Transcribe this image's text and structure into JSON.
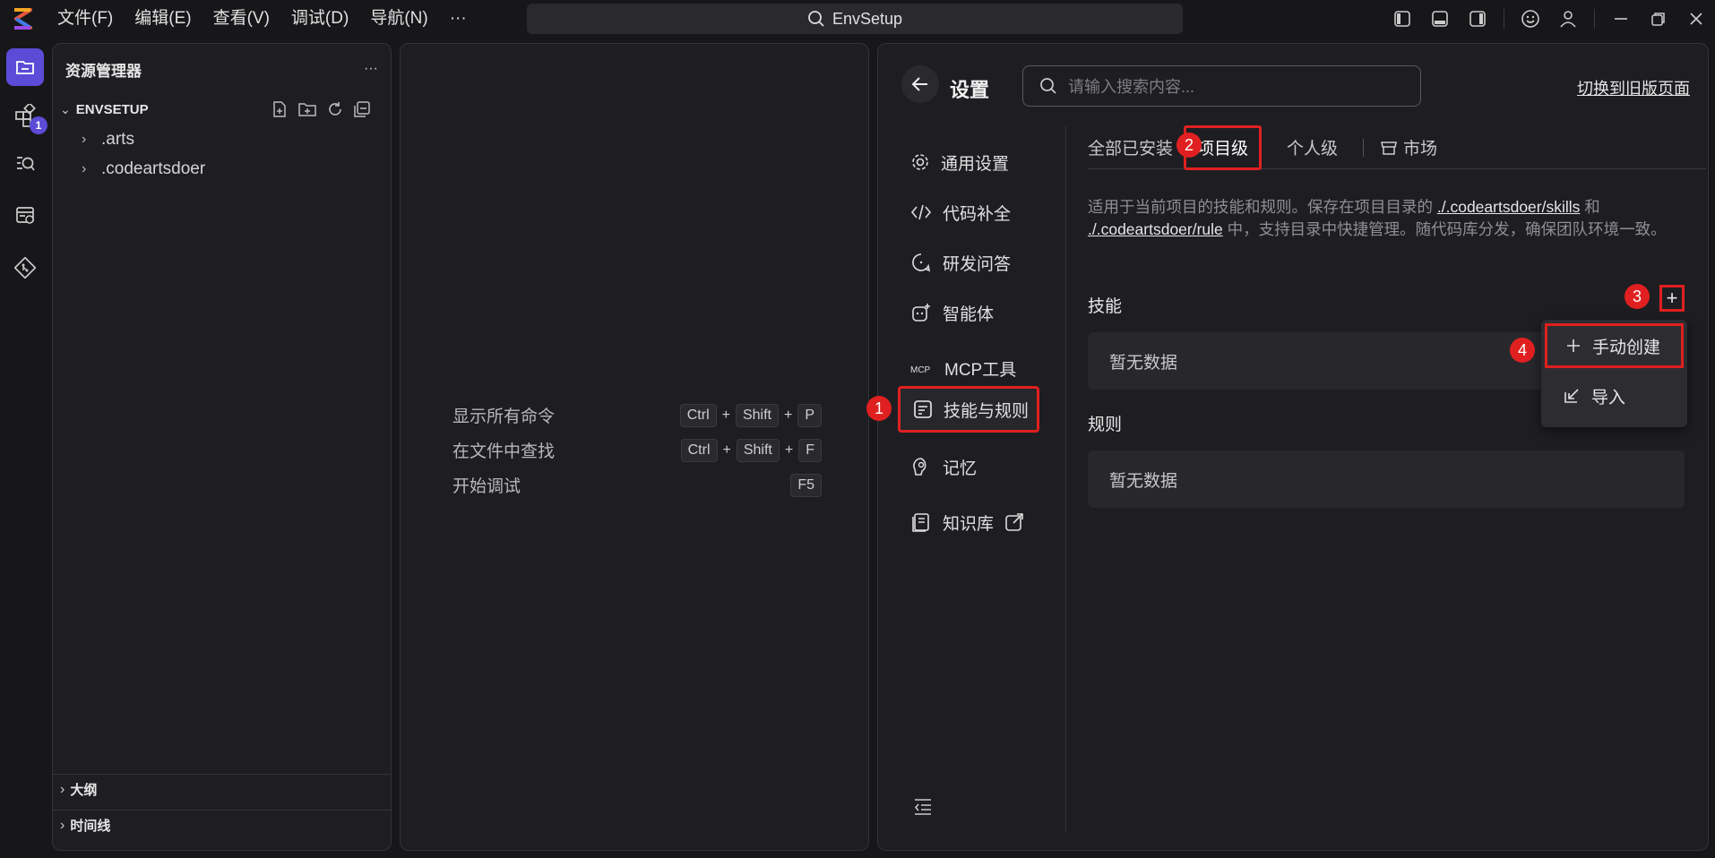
{
  "titlebar": {
    "menu": [
      "文件(F)",
      "编辑(E)",
      "查看(V)",
      "调试(D)",
      "导航(N)",
      "···"
    ],
    "search": "EnvSetup"
  },
  "activity": {
    "badge": "1"
  },
  "explorer": {
    "title": "资源管理器",
    "more": "···",
    "root": "ENVSETUP",
    "items": [
      ".arts",
      ".codeartsdoer"
    ],
    "outline": "大纲",
    "timeline": "时间线"
  },
  "editor": {
    "commands": [
      {
        "label": "显示所有命令",
        "keys": [
          "Ctrl",
          "Shift",
          "P"
        ]
      },
      {
        "label": "在文件中查找",
        "keys": [
          "Ctrl",
          "Shift",
          "F"
        ]
      },
      {
        "label": "开始调试",
        "keys": [
          "F5"
        ]
      }
    ],
    "plus": "+"
  },
  "settings": {
    "title": "设置",
    "search_placeholder": "请输入搜索内容...",
    "old_page": "切换到旧版页面",
    "nav": [
      "通用设置",
      "代码补全",
      "研发问答",
      "智能体",
      "MCP工具",
      "技能与规则",
      "记忆",
      "知识库"
    ],
    "tabs": [
      "全部已安装",
      "项目级",
      "个人级",
      "市场"
    ],
    "desc_pre": "适用于当前项目的技能和规则。保存在项目目录的 ",
    "desc_link1": "./.codeartsdoer/skills",
    "desc_mid": " 和 ",
    "desc_link2": "./.codeartsdoer/rule",
    "desc_post": " 中，支持目录中快捷管理。随代码库分发，确保团队环境一致。",
    "skills_title": "技能",
    "rules_title": "规则",
    "empty": "暂无数据",
    "add": "+",
    "dropdown": [
      "手动创建",
      "导入"
    ]
  },
  "markers": [
    "1",
    "2",
    "3",
    "4"
  ],
  "colors": {
    "accent": "#5b4bd6",
    "highlight": "#e02020"
  }
}
